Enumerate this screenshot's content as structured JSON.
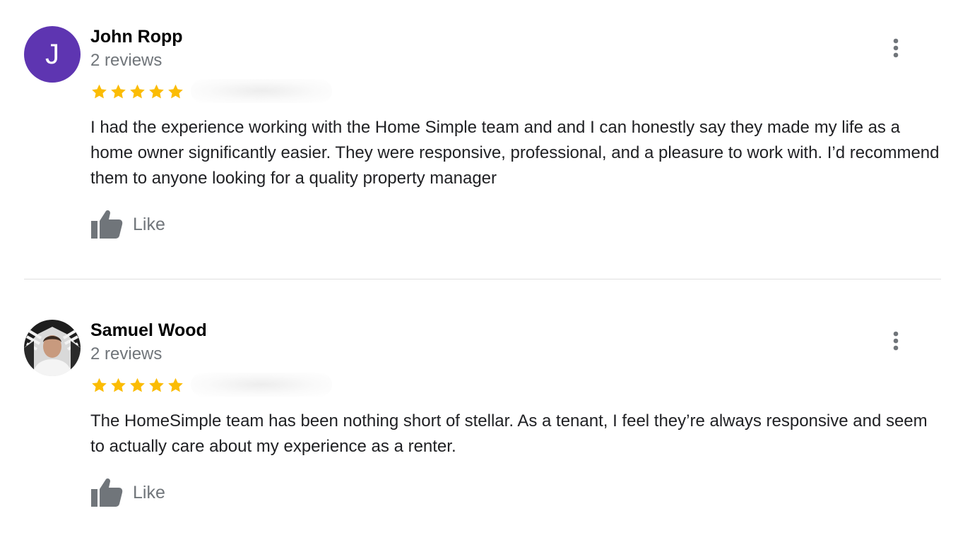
{
  "reviews": [
    {
      "avatar": {
        "type": "letter",
        "letter": "J",
        "color": "#5e35b1"
      },
      "name": "John Ropp",
      "review_count": "2 reviews",
      "rating": 5,
      "text": "I had the experience working with the Home Simple team and and I can honestly say they made my life as a home owner significantly easier. They were responsive, professional, and a pleasure to work with. I’d recommend them to anyone looking for a quality property manager",
      "like_label": "Like"
    },
    {
      "avatar": {
        "type": "photo"
      },
      "name": "Samuel Wood",
      "review_count": "2 reviews",
      "rating": 5,
      "text": "The HomeSimple team has been nothing short of stellar. As a tenant, I feel they’re always responsive and seem to actually care about my experience as a renter.",
      "like_label": "Like"
    }
  ],
  "icons": {
    "star": "star-icon",
    "like": "thumb-up-icon",
    "more": "more-vertical-icon"
  },
  "colors": {
    "star": "#fbbc04",
    "secondary_text": "#70757a",
    "icon": "#70757a",
    "divider": "#e0e0e0"
  }
}
